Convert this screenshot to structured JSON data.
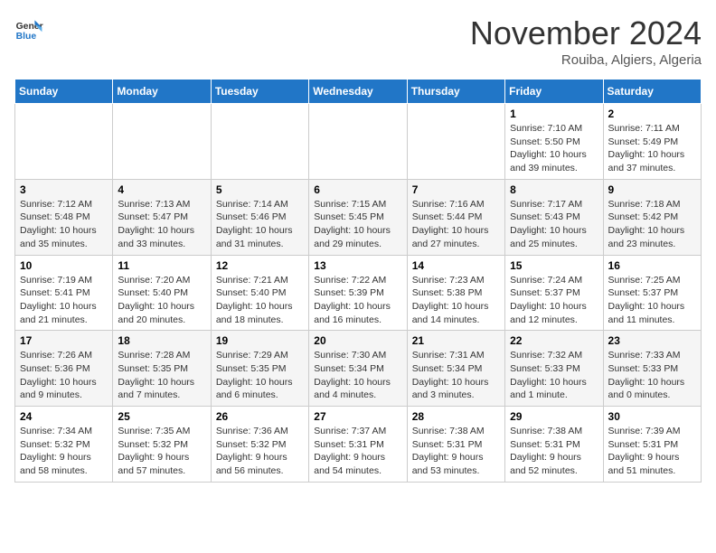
{
  "logo": {
    "line1": "General",
    "line2": "Blue"
  },
  "title": "November 2024",
  "subtitle": "Rouiba, Algiers, Algeria",
  "weekdays": [
    "Sunday",
    "Monday",
    "Tuesday",
    "Wednesday",
    "Thursday",
    "Friday",
    "Saturday"
  ],
  "weeks": [
    [
      {
        "day": "",
        "info": ""
      },
      {
        "day": "",
        "info": ""
      },
      {
        "day": "",
        "info": ""
      },
      {
        "day": "",
        "info": ""
      },
      {
        "day": "",
        "info": ""
      },
      {
        "day": "1",
        "info": "Sunrise: 7:10 AM\nSunset: 5:50 PM\nDaylight: 10 hours\nand 39 minutes."
      },
      {
        "day": "2",
        "info": "Sunrise: 7:11 AM\nSunset: 5:49 PM\nDaylight: 10 hours\nand 37 minutes."
      }
    ],
    [
      {
        "day": "3",
        "info": "Sunrise: 7:12 AM\nSunset: 5:48 PM\nDaylight: 10 hours\nand 35 minutes."
      },
      {
        "day": "4",
        "info": "Sunrise: 7:13 AM\nSunset: 5:47 PM\nDaylight: 10 hours\nand 33 minutes."
      },
      {
        "day": "5",
        "info": "Sunrise: 7:14 AM\nSunset: 5:46 PM\nDaylight: 10 hours\nand 31 minutes."
      },
      {
        "day": "6",
        "info": "Sunrise: 7:15 AM\nSunset: 5:45 PM\nDaylight: 10 hours\nand 29 minutes."
      },
      {
        "day": "7",
        "info": "Sunrise: 7:16 AM\nSunset: 5:44 PM\nDaylight: 10 hours\nand 27 minutes."
      },
      {
        "day": "8",
        "info": "Sunrise: 7:17 AM\nSunset: 5:43 PM\nDaylight: 10 hours\nand 25 minutes."
      },
      {
        "day": "9",
        "info": "Sunrise: 7:18 AM\nSunset: 5:42 PM\nDaylight: 10 hours\nand 23 minutes."
      }
    ],
    [
      {
        "day": "10",
        "info": "Sunrise: 7:19 AM\nSunset: 5:41 PM\nDaylight: 10 hours\nand 21 minutes."
      },
      {
        "day": "11",
        "info": "Sunrise: 7:20 AM\nSunset: 5:40 PM\nDaylight: 10 hours\nand 20 minutes."
      },
      {
        "day": "12",
        "info": "Sunrise: 7:21 AM\nSunset: 5:40 PM\nDaylight: 10 hours\nand 18 minutes."
      },
      {
        "day": "13",
        "info": "Sunrise: 7:22 AM\nSunset: 5:39 PM\nDaylight: 10 hours\nand 16 minutes."
      },
      {
        "day": "14",
        "info": "Sunrise: 7:23 AM\nSunset: 5:38 PM\nDaylight: 10 hours\nand 14 minutes."
      },
      {
        "day": "15",
        "info": "Sunrise: 7:24 AM\nSunset: 5:37 PM\nDaylight: 10 hours\nand 12 minutes."
      },
      {
        "day": "16",
        "info": "Sunrise: 7:25 AM\nSunset: 5:37 PM\nDaylight: 10 hours\nand 11 minutes."
      }
    ],
    [
      {
        "day": "17",
        "info": "Sunrise: 7:26 AM\nSunset: 5:36 PM\nDaylight: 10 hours\nand 9 minutes."
      },
      {
        "day": "18",
        "info": "Sunrise: 7:28 AM\nSunset: 5:35 PM\nDaylight: 10 hours\nand 7 minutes."
      },
      {
        "day": "19",
        "info": "Sunrise: 7:29 AM\nSunset: 5:35 PM\nDaylight: 10 hours\nand 6 minutes."
      },
      {
        "day": "20",
        "info": "Sunrise: 7:30 AM\nSunset: 5:34 PM\nDaylight: 10 hours\nand 4 minutes."
      },
      {
        "day": "21",
        "info": "Sunrise: 7:31 AM\nSunset: 5:34 PM\nDaylight: 10 hours\nand 3 minutes."
      },
      {
        "day": "22",
        "info": "Sunrise: 7:32 AM\nSunset: 5:33 PM\nDaylight: 10 hours\nand 1 minute."
      },
      {
        "day": "23",
        "info": "Sunrise: 7:33 AM\nSunset: 5:33 PM\nDaylight: 10 hours\nand 0 minutes."
      }
    ],
    [
      {
        "day": "24",
        "info": "Sunrise: 7:34 AM\nSunset: 5:32 PM\nDaylight: 9 hours\nand 58 minutes."
      },
      {
        "day": "25",
        "info": "Sunrise: 7:35 AM\nSunset: 5:32 PM\nDaylight: 9 hours\nand 57 minutes."
      },
      {
        "day": "26",
        "info": "Sunrise: 7:36 AM\nSunset: 5:32 PM\nDaylight: 9 hours\nand 56 minutes."
      },
      {
        "day": "27",
        "info": "Sunrise: 7:37 AM\nSunset: 5:31 PM\nDaylight: 9 hours\nand 54 minutes."
      },
      {
        "day": "28",
        "info": "Sunrise: 7:38 AM\nSunset: 5:31 PM\nDaylight: 9 hours\nand 53 minutes."
      },
      {
        "day": "29",
        "info": "Sunrise: 7:38 AM\nSunset: 5:31 PM\nDaylight: 9 hours\nand 52 minutes."
      },
      {
        "day": "30",
        "info": "Sunrise: 7:39 AM\nSunset: 5:31 PM\nDaylight: 9 hours\nand 51 minutes."
      }
    ]
  ]
}
